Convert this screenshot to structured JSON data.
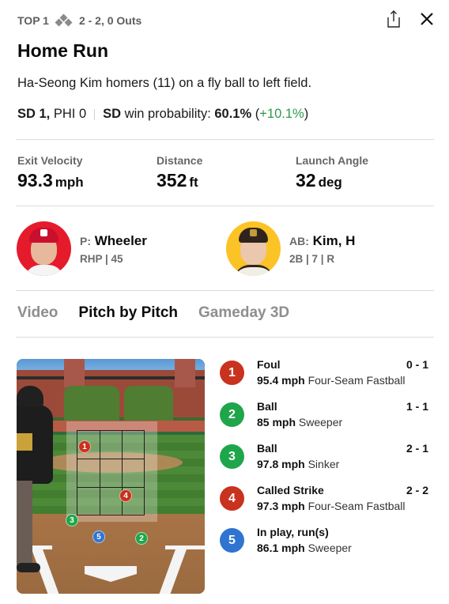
{
  "header": {
    "inning": "TOP 1",
    "count_outs": "2 - 2, 0 Outs",
    "bases_icon": "bases-diamond-icon",
    "share_icon": "share-icon",
    "close_icon": "close-icon"
  },
  "play": {
    "title": "Home Run",
    "description": "Ha-Seong Kim homers (11) on a fly ball to left field.",
    "score_leader": "SD 1,",
    "score_trailer": " PHI 0",
    "wp_team": "SD",
    "wp_label": " win probability: ",
    "wp_value": "60.1%",
    "wp_open": " (",
    "wp_delta": "+10.1%",
    "wp_close": ")"
  },
  "stats": [
    {
      "label": "Exit Velocity",
      "value": "93.3",
      "unit": "mph"
    },
    {
      "label": "Distance",
      "value": "352",
      "unit": "ft"
    },
    {
      "label": "Launch Angle",
      "value": "32",
      "unit": "deg"
    }
  ],
  "pitcher": {
    "role": "P:",
    "name": "Wheeler",
    "details": "RHP | 45",
    "avatar_color": "#e51b2b"
  },
  "batter": {
    "role": "AB:",
    "name": "Kim, H",
    "details": "2B | 7 | R",
    "avatar_color": "#fcc326"
  },
  "tabs": [
    {
      "label": "Video",
      "active": false
    },
    {
      "label": "Pitch by Pitch",
      "active": true
    },
    {
      "label": "Gameday 3D",
      "active": false
    }
  ],
  "colors": {
    "strike": "#c8321e",
    "ball": "#1fa64a",
    "in_play": "#2f74d0",
    "delta_positive": "#2e9a4e"
  },
  "pitches": [
    {
      "num": "1",
      "result": "Foul",
      "count": "0 - 1",
      "speed": "95.4 mph",
      "type": "Four-Seam Fastball",
      "kind": "strike"
    },
    {
      "num": "2",
      "result": "Ball",
      "count": "1 - 1",
      "speed": "85 mph",
      "type": "Sweeper",
      "kind": "ball"
    },
    {
      "num": "3",
      "result": "Ball",
      "count": "2 - 1",
      "speed": "97.8 mph",
      "type": "Sinker",
      "kind": "ball"
    },
    {
      "num": "4",
      "result": "Called Strike",
      "count": "2 - 2",
      "speed": "97.3 mph",
      "type": "Four-Seam Fastball",
      "kind": "strike"
    },
    {
      "num": "5",
      "result": "In play, run(s)",
      "count": "",
      "speed": "86.1 mph",
      "type": "Sweeper",
      "kind": "in_play"
    }
  ]
}
